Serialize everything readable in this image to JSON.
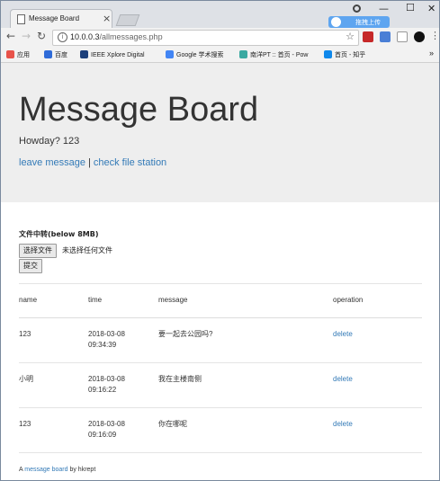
{
  "browser": {
    "tab_title": "Message Board",
    "tab_close": "×",
    "upload_button": "拖拽上传",
    "url_host": "10.0.0.3",
    "url_path": "/allmessages.php",
    "bookmarks": [
      "应用",
      "百度",
      "IEEE Xplore Digital",
      "Google 学术搜索",
      "南洋PT :: 首页 - Pow",
      "首页 - 知乎"
    ],
    "more_bookmarks": "»"
  },
  "page": {
    "title": "Message Board",
    "greeting": "Howday? 123",
    "link_leave": "leave message",
    "link_sep": "|",
    "link_file": "check file station",
    "upload_label": "文件中转(below 8MB)",
    "file_button": "选择文件",
    "no_file": "未选择任何文件",
    "submit": "提交"
  },
  "table": {
    "headers": [
      "name",
      "time",
      "message",
      "operation"
    ],
    "rows": [
      {
        "name": "123",
        "date": "2018-03-08",
        "clock": "09:34:39",
        "message": "要一起去公园吗?",
        "op": "delete"
      },
      {
        "name": "小明",
        "date": "2018-03-08",
        "clock": "09:16:22",
        "message": "我在主楼南侧",
        "op": "delete"
      },
      {
        "name": "123",
        "date": "2018-03-08",
        "clock": "09:16:09",
        "message": "你在哪呢",
        "op": "delete"
      }
    ]
  },
  "footer": {
    "prefix": "A",
    "link": "message board",
    "suffix": "by hkrept"
  },
  "colors": {
    "link": "#337ab7",
    "jumbotron": "#eeeeee",
    "upload_badge": "#5ea5f0"
  }
}
